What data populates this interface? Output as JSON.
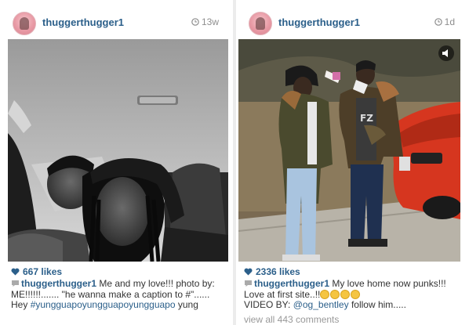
{
  "posts": [
    {
      "username": "thuggerthugger1",
      "time": "13w",
      "likes": "667 likes",
      "caption_user": "thuggerthugger1",
      "caption_line1": " Me and my love!!! photo by: ME!!!!!!....... \"he wanna make a caption to #\"...... Hey ",
      "hashtag": "#yungguapoyungguapoyungguapo",
      "caption_tail": " yung",
      "photo_icon": "car-selfie-photo"
    },
    {
      "username": "thuggerthugger1",
      "time": "1d",
      "likes": "2336 likes",
      "caption_user": "thuggerthugger1",
      "caption_line1": " My love home now punks!!! Love at first site..!!",
      "caption_line2": "VIDEO BY: ",
      "mention": "@og_bentley",
      "caption_line3": " follow him.....",
      "view_all": "view all 443 comments",
      "photo_icon": "outdoor-video-photo"
    }
  ],
  "colors": {
    "link": "#2b5f8a",
    "muted": "#8e8e8e",
    "car": "#d6361f"
  },
  "icons": [
    "clock-icon",
    "heart-icon",
    "comment-icon",
    "sound-icon",
    "crying-laughing-emoji"
  ]
}
